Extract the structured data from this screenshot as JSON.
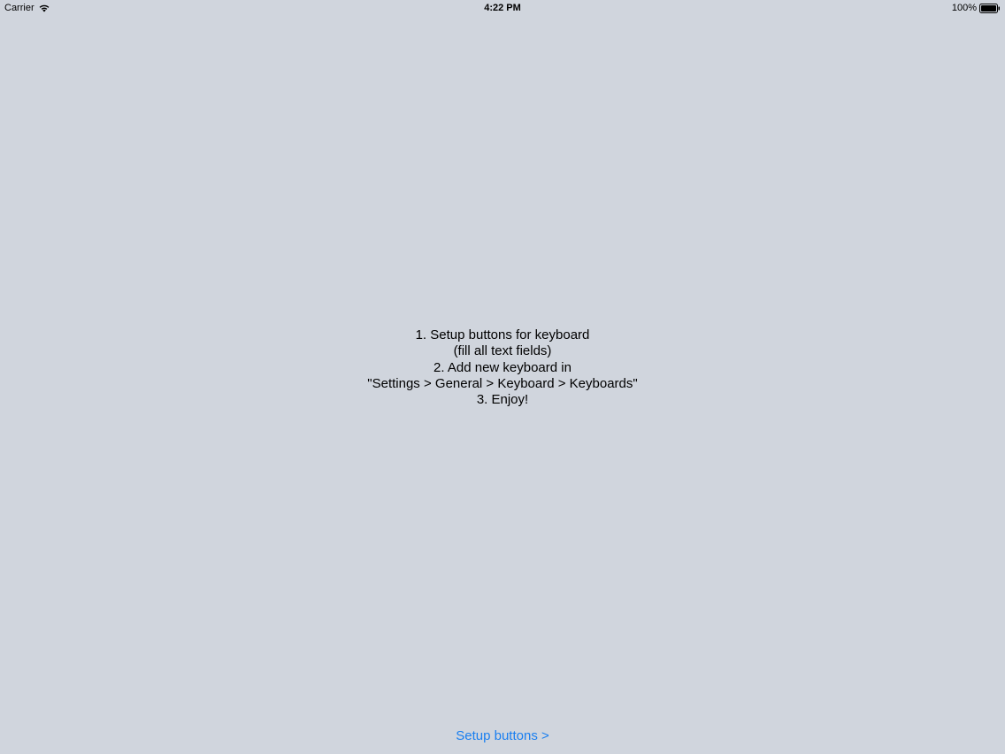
{
  "status_bar": {
    "carrier": "Carrier",
    "time": "4:22 PM",
    "battery_percent": "100%",
    "wifi_icon": "wifi-icon",
    "battery_icon": "battery-full-icon"
  },
  "instructions": {
    "line1": "1. Setup buttons for keyboard",
    "line2": "(fill all text fields)",
    "line3": "2. Add new keyboard in",
    "line4": "\"Settings > General > Keyboard > Keyboards\"",
    "line5": "3. Enjoy!"
  },
  "setup_button": {
    "label": "Setup buttons >"
  },
  "colors": {
    "background": "#d0d5dd",
    "accent": "#1a7ff0",
    "text": "#000000"
  }
}
